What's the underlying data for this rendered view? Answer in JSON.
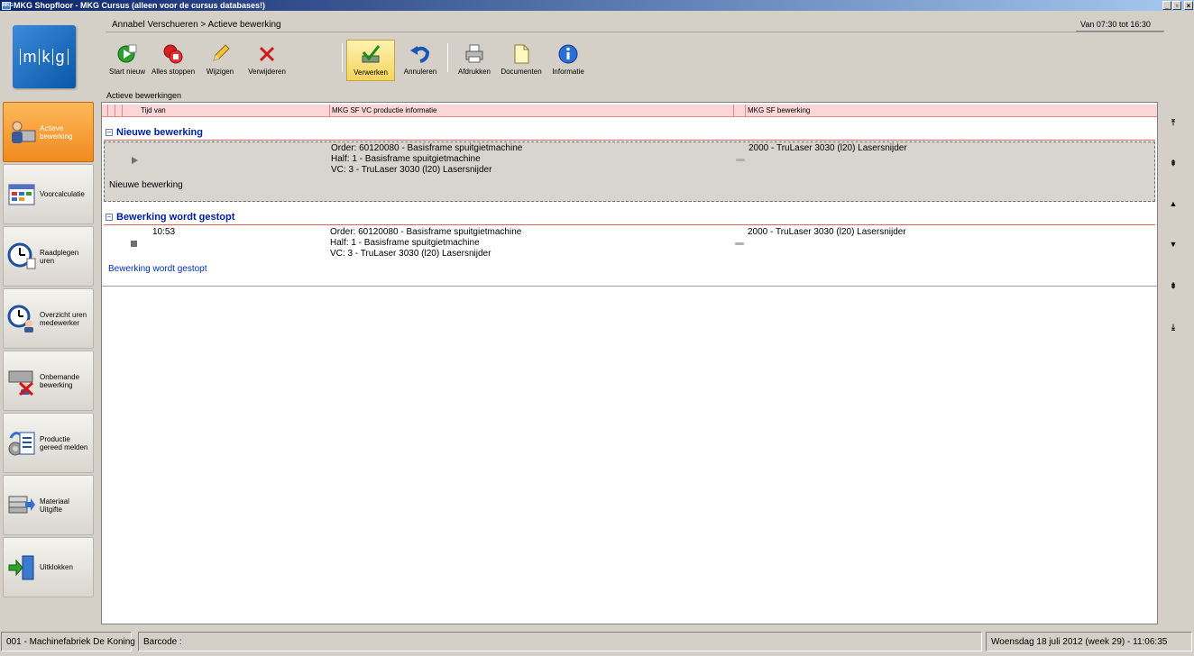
{
  "window": {
    "title": "MKG Shopfloor - MKG Cursus (alleen voor de cursus databases!)",
    "app_icon_text": "MKG"
  },
  "header": {
    "breadcrumb": "Annabel Verschueren > Actieve bewerking",
    "time_slot": "Van 07:30 tot 16:30"
  },
  "logo": {
    "letters": [
      "m",
      "k",
      "g"
    ]
  },
  "toolbar": {
    "buttons": [
      {
        "label": "Start nieuw",
        "icon": "start-new-icon"
      },
      {
        "label": "Alles stoppen",
        "icon": "stop-all-icon"
      },
      {
        "label": "Wijzigen",
        "icon": "pencil-icon"
      },
      {
        "label": "Verwijderen",
        "icon": "delete-x-icon"
      },
      {
        "label": "Verwerken",
        "icon": "process-check-icon",
        "active": true
      },
      {
        "label": "Annuleren",
        "icon": "undo-icon"
      },
      {
        "label": "Afdrukken",
        "icon": "printer-icon"
      },
      {
        "label": "Documenten",
        "icon": "document-icon"
      },
      {
        "label": "Informatie",
        "icon": "info-icon"
      }
    ]
  },
  "sidebar": {
    "items": [
      {
        "label": "Actieve bewerking",
        "icon": "worker-machine-icon",
        "active": true
      },
      {
        "label": "Voorcalculatie",
        "icon": "calculation-grid-icon"
      },
      {
        "label": "Raadplegen uren",
        "icon": "clock-icon"
      },
      {
        "label": "Overzicht uren medewerker",
        "icon": "clock-person-icon"
      },
      {
        "label": "Onbemande bewerking",
        "icon": "unmanned-machine-icon"
      },
      {
        "label": "Productie gereed melden",
        "icon": "production-done-icon"
      },
      {
        "label": "Materiaal Uitgifte",
        "icon": "material-issue-icon"
      },
      {
        "label": "Uitklokken",
        "icon": "clock-out-icon"
      }
    ]
  },
  "main": {
    "panel_title": "Actieve bewerkingen",
    "columns": [
      "Tijd van",
      "MKG SF VC productie informatie",
      "MKG SF bewerking"
    ],
    "groups": [
      {
        "title": "Nieuwe bewerking",
        "rows": [
          {
            "status_icon": "play-icon",
            "time": "",
            "info": [
              "Order: 60120080 - Basisframe spuitgietmachine",
              "Half: 1 - Basisframe spuitgietmachine",
              "VC: 3 - TruLaser 3030 (l20) Lasersnijder"
            ],
            "operation": "2000 - TruLaser 3030 (l20) Lasersnijder",
            "footer": "Nieuwe bewerking",
            "selected": true
          }
        ]
      },
      {
        "title": "Bewerking wordt gestopt",
        "rows": [
          {
            "status_icon": "stop-icon",
            "time": "10:53",
            "info": [
              "Order: 60120080 - Basisframe spuitgietmachine",
              "Half: 1 - Basisframe spuitgietmachine",
              "VC: 3 - TruLaser 3030 (l20) Lasersnijder"
            ],
            "operation": "2000 - TruLaser 3030 (l20) Lasersnijder",
            "footer": "Bewerking wordt gestopt",
            "selected": false
          }
        ]
      }
    ]
  },
  "scroll_buttons": [
    "scroll-top-icon",
    "page-up-icon",
    "line-up-icon",
    "line-down-icon",
    "page-down-icon",
    "scroll-bottom-icon"
  ],
  "statusbar": {
    "company": "001 - Machinefabriek De Koning",
    "barcode_label": "Barcode :",
    "datetime": "Woensdag 18 juli 2012 (week 29)  -  11:06:35"
  }
}
